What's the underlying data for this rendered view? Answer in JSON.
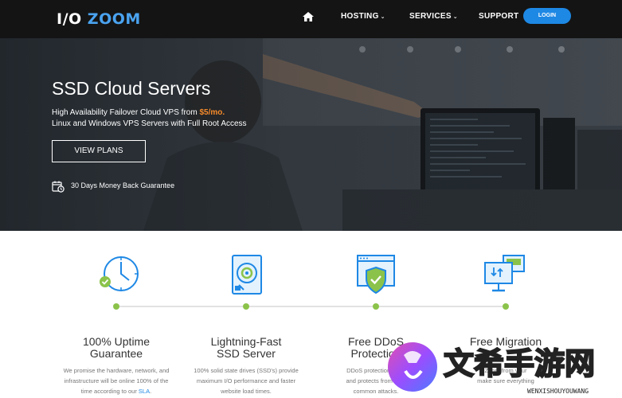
{
  "brand": {
    "logo_part1": "I/O",
    "logo_part2": "ZOOM"
  },
  "nav": {
    "items": [
      {
        "label": "HOSTING",
        "has_dropdown": true
      },
      {
        "label": "SERVICES",
        "has_dropdown": true
      },
      {
        "label": "SUPPORT",
        "has_dropdown": false
      }
    ],
    "login_label": "LOGIN",
    "home_icon": "home-icon"
  },
  "hero": {
    "title": "SSD Cloud Servers",
    "subtitle_prefix": "High Availability Failover Cloud VPS from ",
    "subtitle_price": "$5/mo.",
    "subtitle_line2": "Linux and Windows VPS Servers with Full Root Access",
    "cta_label": "VIEW PLANS",
    "guarantee_text": "30 Days Money Back Guarantee"
  },
  "features": [
    {
      "icon": "clock-check-icon",
      "title_line1": "100% Uptime",
      "title_line2": "Guarantee",
      "desc_line1": "We promise the hardware, network, and",
      "desc_line2": "infrastructure will be online 100% of the",
      "desc_line3_prefix": "time according to our ",
      "desc_link": "SLA",
      "desc_line3_suffix": "."
    },
    {
      "icon": "ssd-drive-icon",
      "title_line1": "Lightning-Fast",
      "title_line2": "SSD Server",
      "desc_line1": "100% solid state drives (SSD's) provide",
      "desc_line2": "maximum I/O performance and faster",
      "desc_line3": "website load times."
    },
    {
      "icon": "shield-monitor-icon",
      "title_line1": "Free DDoS",
      "title_line2": "Protection",
      "desc_line1": "DDoS protection up to",
      "desc_line2": "and protects from over",
      "desc_line3": "common attacks."
    },
    {
      "icon": "migration-monitors-icon",
      "title_line1": "Free Migration",
      "title_line2": "",
      "desc_line1": "Zoom from your",
      "desc_line2": "make sure everything"
    }
  ],
  "watermark": {
    "text": "文希手游网",
    "sub": "WENXISHOUYOUWANG"
  },
  "colors": {
    "accent": "#1e88e5",
    "price": "#f58a2a",
    "timeline_dot": "#8bc34a",
    "nav_bg": "#141414"
  }
}
